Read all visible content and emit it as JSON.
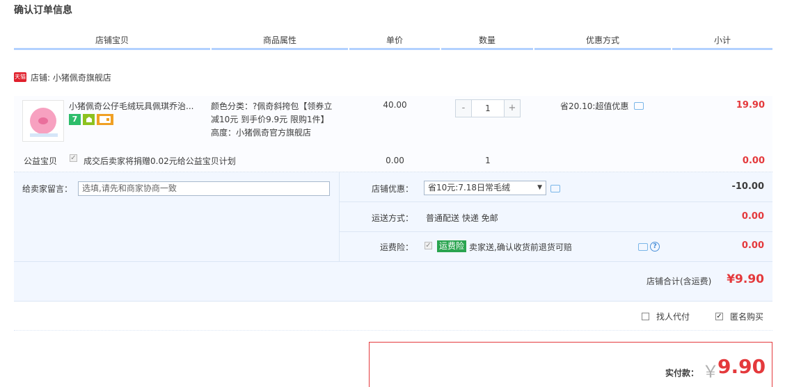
{
  "page_title": "确认订单信息",
  "columns": [
    "店铺宝贝",
    "商品属性",
    "单价",
    "数量",
    "优惠方式",
    "小计"
  ],
  "shop": {
    "badge_text": "天猫",
    "label": "店铺: 小猪佩奇旗舰店"
  },
  "item": {
    "title": "小猪佩奇公仔毛绒玩具佩琪乔治...",
    "badges": [
      "7",
      "",
      ""
    ],
    "attr_line1": "颜色分类：?佩奇斜挎包【领券立",
    "attr_line2": "减10元 到手价9.9元 限购1件】",
    "attr_line3": "高度：小猪佩奇官方旗舰店",
    "price": "40.00",
    "qty_minus": "-",
    "qty": "1",
    "qty_plus": "+",
    "discount": "省20.10:超值优惠",
    "subtotal": "19.90"
  },
  "charity": {
    "label": "公益宝贝",
    "check_mark": "✓",
    "text": "成交后卖家将捐赠0.02元给公益宝贝计划",
    "price": "0.00",
    "qty": "1",
    "subtotal": "0.00"
  },
  "note": {
    "label": "给卖家留言：",
    "placeholder": "选填,请先和商家协商一致"
  },
  "shop_discount": {
    "label": "店铺优惠：",
    "selected": "省10元:7.18日常毛绒",
    "arrow": "▼",
    "amount": "-10.00"
  },
  "shipping": {
    "label": "运送方式：",
    "value": "普通配送 快递 免邮",
    "amount": "0.00"
  },
  "insurance": {
    "label": "运费险：",
    "check_mark": "✓",
    "tag": "运费险",
    "text": "卖家送,确认收货前退货可赔",
    "help": "?",
    "amount": "0.00"
  },
  "shop_total": {
    "label": "店铺合计(含运费)",
    "value": "¥9.90"
  },
  "options": {
    "proxy_label": "找人代付",
    "anonymous_label": "匿名购买",
    "anonymous_check": "✓"
  },
  "payment": {
    "label": "实付款：",
    "currency": "￥",
    "value": "9.90"
  }
}
